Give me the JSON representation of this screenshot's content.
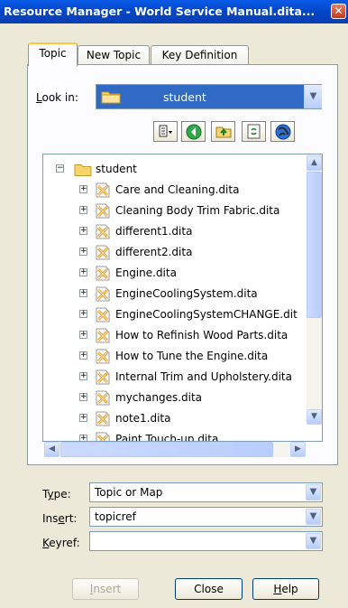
{
  "window": {
    "title": "Resource Manager - World Service Manual.dita..."
  },
  "tabs": [
    {
      "label": "Topic"
    },
    {
      "label": "New Topic"
    },
    {
      "label": "Key Definition"
    }
  ],
  "lookin": {
    "label": "Look in:",
    "value": "student"
  },
  "toolbar": [
    {
      "icon": "view-menu-icon"
    },
    {
      "icon": "back-icon"
    },
    {
      "icon": "up-folder-icon"
    },
    {
      "icon": "refresh-icon"
    },
    {
      "icon": "globe-icon"
    }
  ],
  "tree": {
    "root": "student",
    "files": [
      "Care and Cleaning.dita",
      "Cleaning Body Trim Fabric.dita",
      "different1.dita",
      "different2.dita",
      "Engine.dita",
      "EngineCoolingSystem.dita",
      "EngineCoolingSystemCHANGE.dit",
      "How to Refinish Wood Parts.dita",
      "How to Tune the Engine.dita",
      "Internal Trim and Upholstery.dita",
      "mychanges.dita",
      "note1.dita",
      "Paint Touch-up.dita"
    ]
  },
  "fields": {
    "type": {
      "label": "Type:",
      "value": "Topic or Map"
    },
    "insert": {
      "label": "Insert:",
      "value": "topicref"
    },
    "keyref": {
      "label": "Keyref:",
      "value": ""
    }
  },
  "buttons": {
    "insert": "Insert",
    "close": "Close",
    "help": "Help"
  },
  "colors": {
    "titlebar": "#0a5be8",
    "selection": "#316ac5",
    "dialog": "#ece9d8"
  }
}
